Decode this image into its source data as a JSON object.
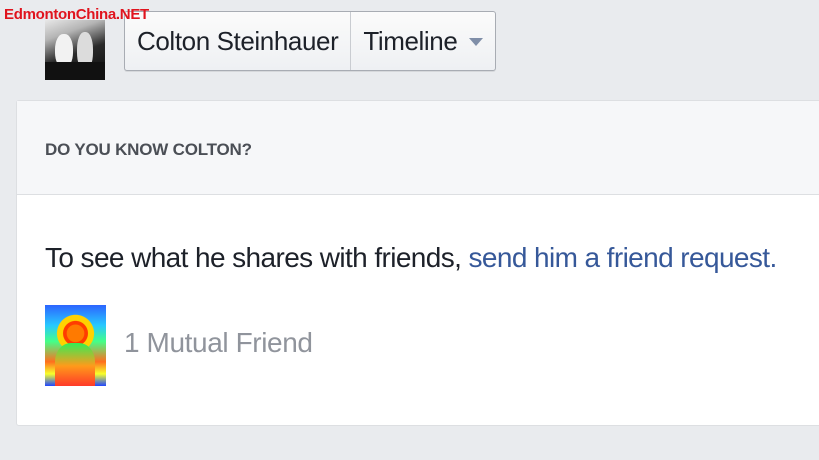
{
  "watermark": "EdmontonChina.NET",
  "header": {
    "name_button": "Colton Steinhauer",
    "timeline_button": "Timeline"
  },
  "card": {
    "title": "DO YOU KNOW COLTON?",
    "message_text": "To see what he shares with friends, ",
    "message_link": "send him a friend request.",
    "mutual_friends": "1 Mutual Friend"
  },
  "colors": {
    "link": "#365899",
    "background": "#e9ebee",
    "watermark": "#e0141e"
  },
  "icons": {
    "timeline_dropdown": "chevron-down-icon"
  }
}
